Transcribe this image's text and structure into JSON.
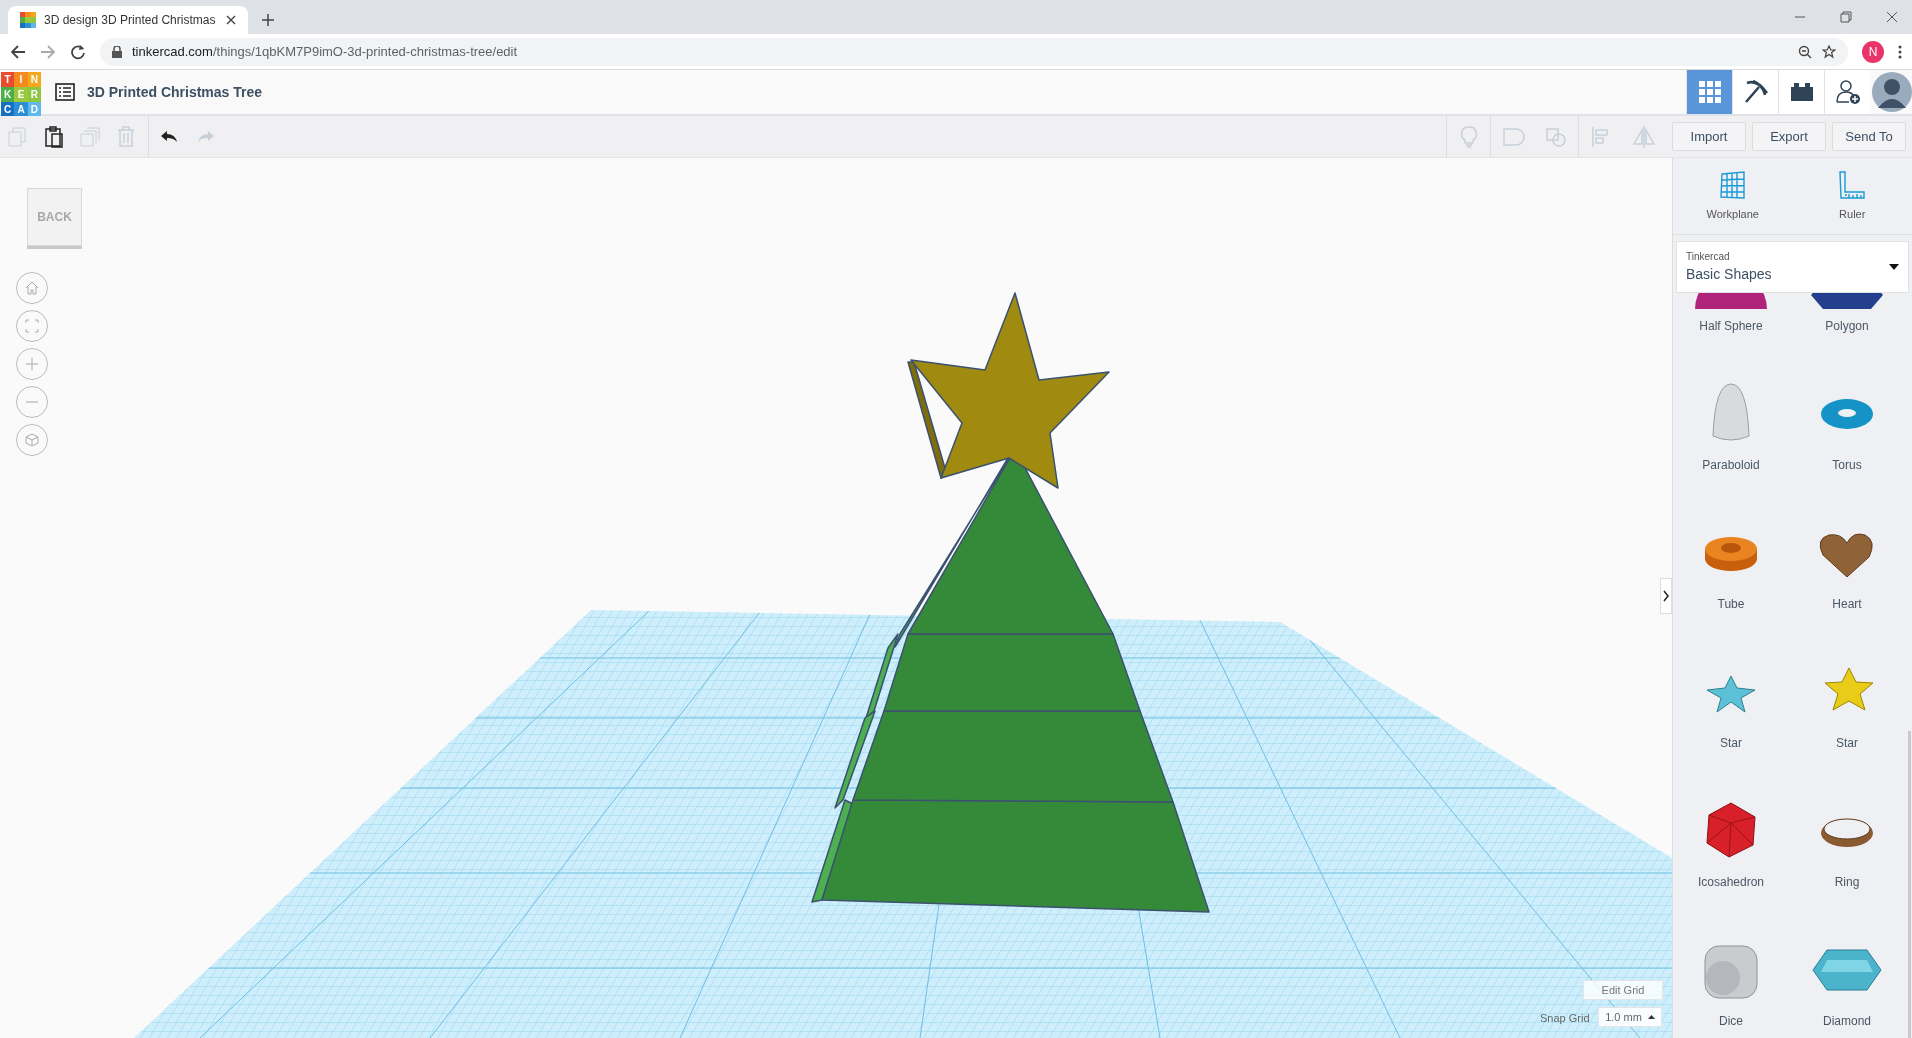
{
  "browser": {
    "tab_title": "3D design 3D Printed Christmas",
    "url_host": "tinkercad.com",
    "url_path": "/things/1qbKM7P9imO-3d-printed-christmas-tree/edit",
    "profile_initial": "N"
  },
  "logo_letters": [
    "T",
    "I",
    "N",
    "K",
    "E",
    "R",
    "C",
    "A",
    "D"
  ],
  "design_title": "3D Printed Christmas Tree",
  "view_buttons": [
    {
      "selected": true
    },
    {
      "selected": false
    },
    {
      "selected": false
    }
  ],
  "toolbar_left": [
    {
      "disabled": true
    },
    {
      "disabled": false
    },
    {
      "disabled": true
    },
    {
      "disabled": true
    },
    {
      "disabled": false
    },
    {
      "disabled": true
    }
  ],
  "toolbar_right": [
    {
      "disabled": true
    },
    {
      "disabled": true
    },
    {
      "disabled": true
    },
    {
      "disabled": true
    },
    {
      "disabled": true
    }
  ],
  "actions": [
    "Import",
    "Export",
    "Send To"
  ],
  "back_label": "BACK",
  "panel": {
    "tools": [
      "Workplane",
      "Ruler"
    ],
    "library": {
      "source": "Tinkercad",
      "category": "Basic Shapes"
    },
    "shapes": [
      "Half Sphere",
      "Polygon",
      "Paraboloid",
      "Torus",
      "Tube",
      "Heart",
      "Star",
      "Star",
      "Icosahedron",
      "Ring",
      "Dice",
      "Diamond"
    ]
  },
  "grid": {
    "edit_label": "Edit Grid",
    "snap_label": "Snap Grid",
    "snap_value": "1.0 mm"
  }
}
